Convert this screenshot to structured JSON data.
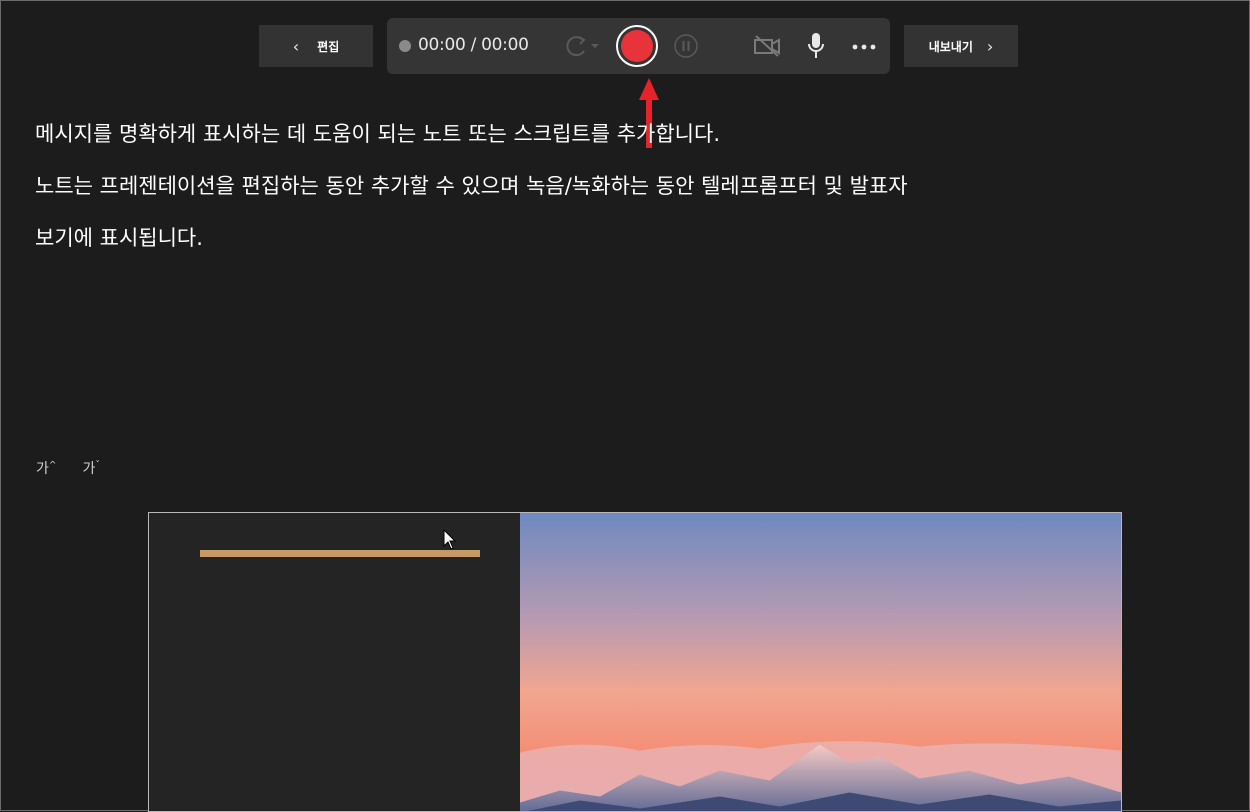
{
  "toolbar": {
    "edit_label": "편집",
    "export_label": "내보내기",
    "timer": "00:00 / 00:00"
  },
  "icons": {
    "back": "chevron-left-icon",
    "forward": "chevron-right-icon",
    "retake": "retake-icon",
    "record": "record-icon",
    "pause": "pause-icon",
    "camera": "camera-off-icon",
    "mic": "microphone-icon",
    "more": "more-icon"
  },
  "colors": {
    "record": "#e8333a",
    "annotation_arrow": "#e8222a",
    "title_accent": "#c89a63"
  },
  "notes": {
    "line1": "메시지를 명확하게 표시하는 데 도움이 되는 노트 또는 스크립트를 추가합니다.",
    "line2": "노트는 프레젠테이션을 편집하는 동안 추가할 수 있으며 녹음/녹화하는 동안 텔레프롬프터 및 발표자",
    "line3": "보기에 표시됩니다."
  },
  "font_controls": {
    "increase": "가",
    "decrease": "가"
  }
}
